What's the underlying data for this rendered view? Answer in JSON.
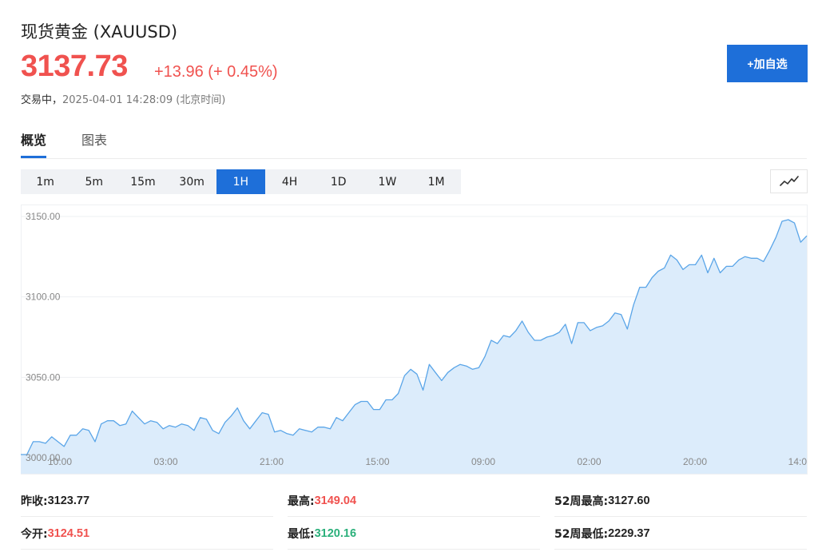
{
  "header": {
    "title": "现货黄金 (XAUUSD)",
    "price": "3137.73",
    "change": "+13.96 (+ 0.45%)",
    "trading_status": "交易中，",
    "timestamp": "2025-04-01 14:28:09  (北京时间)",
    "add_button_label": "+加自选"
  },
  "tabs": [
    {
      "label": "概览",
      "active": true
    },
    {
      "label": "图表",
      "active": false
    }
  ],
  "periods": [
    {
      "label": "1m",
      "active": false
    },
    {
      "label": "5m",
      "active": false
    },
    {
      "label": "15m",
      "active": false
    },
    {
      "label": "30m",
      "active": false
    },
    {
      "label": "1H",
      "active": true
    },
    {
      "label": "4H",
      "active": false
    },
    {
      "label": "1D",
      "active": false
    },
    {
      "label": "1W",
      "active": false
    },
    {
      "label": "1M",
      "active": false
    }
  ],
  "chart_type_icon": "line-chart-icon",
  "chart_data": {
    "type": "area",
    "y_ticks": [
      "3150.00",
      "3100.00",
      "3050.00",
      "3000.00"
    ],
    "ylim": [
      3000,
      3150
    ],
    "x_tick_labels": [
      "10:00",
      "03:00",
      "21:00",
      "15:00",
      "09:00",
      "02:00",
      "20:00",
      "14:0"
    ],
    "series": [
      {
        "values": [
          3002,
          3002,
          3010,
          3010,
          3009,
          3013,
          3010,
          3007,
          3014,
          3014,
          3018,
          3017,
          3010,
          3021,
          3023,
          3023,
          3020,
          3021,
          3029,
          3025,
          3021,
          3023,
          3022,
          3018,
          3020,
          3019,
          3021,
          3020,
          3017,
          3025,
          3024,
          3017,
          3015,
          3022,
          3026,
          3031,
          3023,
          3018,
          3023,
          3028,
          3027,
          3016,
          3017,
          3015,
          3014,
          3018,
          3017,
          3016,
          3019,
          3019,
          3018,
          3025,
          3023,
          3028,
          3033,
          3035,
          3035,
          3030,
          3030,
          3036,
          3036,
          3040,
          3051,
          3055,
          3052,
          3042,
          3058,
          3053,
          3048,
          3053,
          3056,
          3058,
          3057,
          3055,
          3056,
          3063,
          3073,
          3071,
          3076,
          3075,
          3079,
          3085,
          3078,
          3073,
          3073,
          3075,
          3076,
          3078,
          3083,
          3071,
          3084,
          3084,
          3079,
          3081,
          3082,
          3085,
          3090,
          3089,
          3080,
          3095,
          3106,
          3106,
          3112,
          3116,
          3118,
          3126,
          3123,
          3117,
          3120,
          3120,
          3126,
          3115,
          3124,
          3115,
          3119,
          3119,
          3123,
          3125,
          3124,
          3124,
          3122,
          3129,
          3137,
          3147,
          3148,
          3146,
          3134,
          3138
        ]
      }
    ],
    "line_color": "#5aa5e8",
    "fill_color": "#dcecfb",
    "grid": true
  },
  "stats": [
    [
      {
        "label": "昨收:",
        "value": "3123.77",
        "color": "dark"
      },
      {
        "label": "最高:",
        "value": "3149.04",
        "color": "red"
      },
      {
        "label": "52周最高:",
        "value": "3127.60",
        "color": "dark"
      }
    ],
    [
      {
        "label": "今开:",
        "value": "3124.51",
        "color": "red"
      },
      {
        "label": "最低:",
        "value": "3120.16",
        "color": "green"
      },
      {
        "label": "52周最低:",
        "value": "2229.37",
        "color": "dark"
      }
    ]
  ],
  "colors": {
    "up": "#f0524f",
    "down": "#2bb07b",
    "accent": "#1e6fd9"
  }
}
